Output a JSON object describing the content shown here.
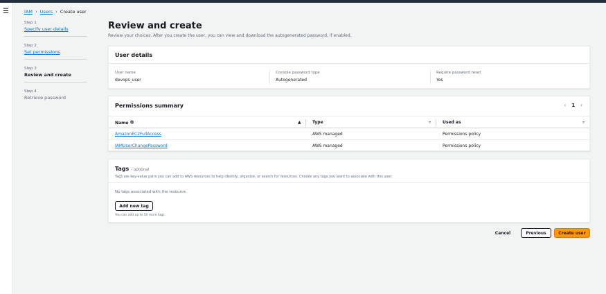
{
  "breadcrumb": {
    "items": [
      "IAM",
      "Users",
      "Create user"
    ]
  },
  "steps": [
    {
      "num": "Step 1",
      "label": "Specify user details"
    },
    {
      "num": "Step 2",
      "label": "Set permissions"
    },
    {
      "num": "Step 3",
      "label": "Review and create"
    },
    {
      "num": "Step 4",
      "label": "Retrieve password"
    }
  ],
  "page": {
    "title": "Review and create",
    "description": "Review your choices. After you create the user, you can view and download the autogenerated password, if enabled."
  },
  "user_details": {
    "title": "User details",
    "fields": [
      {
        "label": "User name",
        "value": "devops_user"
      },
      {
        "label": "Console password type",
        "value": "Autogenerated"
      },
      {
        "label": "Require password reset",
        "value": "Yes"
      }
    ]
  },
  "permissions": {
    "title": "Permissions summary",
    "page_number": "1",
    "columns": [
      "Name",
      "Type",
      "Used as"
    ],
    "rows": [
      {
        "name": "AmazonEC2FullAccess",
        "type": "AWS managed",
        "used_as": "Permissions policy"
      },
      {
        "name": "IAMUserChangePassword",
        "type": "AWS managed",
        "used_as": "Permissions policy"
      }
    ]
  },
  "tags": {
    "title": "Tags",
    "optional": "- optional",
    "description": "Tags are key-value pairs you can add to AWS resources to help identify, organize, or search for resources. Choose any tags you want to associate with this user.",
    "empty_text": "No tags associated with the resource.",
    "add_button": "Add new tag",
    "limit_text": "You can add up to 50 more tags."
  },
  "actions": {
    "cancel": "Cancel",
    "previous": "Previous",
    "create": "Create user"
  },
  "colors": {
    "primary_button": "#ff9900",
    "link": "#0972d3",
    "topbar": "#232f3e"
  }
}
